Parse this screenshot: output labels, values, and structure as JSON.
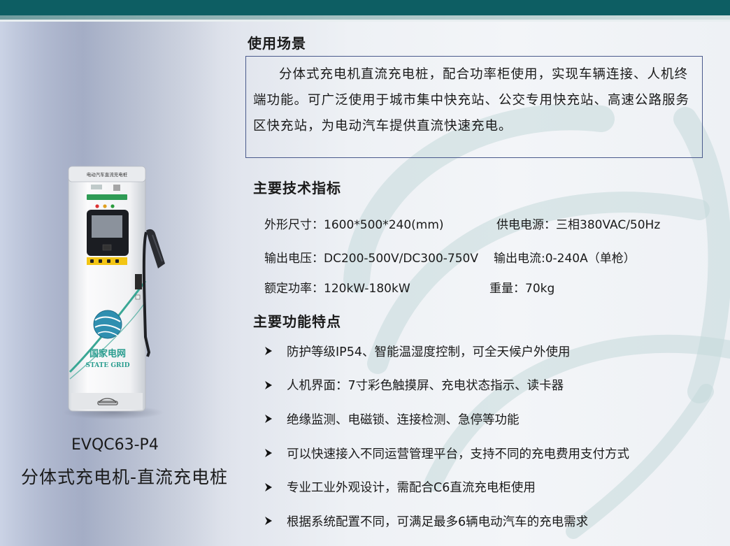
{
  "header": {
    "bar_color": "#0d5e63"
  },
  "usage": {
    "heading": "使用场景",
    "text": "分体式充电机直流充电桩，配合功率柜使用，实现车辆连接、人机终端功能。可广泛使用于城市集中快充站、公交专用快充站、高速公路服务区快充站，为电动汽车提供直流快速充电。"
  },
  "specs": {
    "heading": "主要技术指标",
    "size": "外形尺寸：1600*500*240(mm)",
    "power_supply": "供电电源：三相380VAC/50Hz",
    "output_voltage": "输出电压：DC200-500V/DC300-750V",
    "output_current": "输出电流:0-240A（单枪）",
    "rated_power": "额定功率：120kW-180kW",
    "weight": "重量：70kg"
  },
  "features": {
    "heading": "主要功能特点",
    "items": [
      "防护等级IP54、智能温湿度控制，可全天候户外使用",
      "人机界面：7寸彩色触摸屏、充电状态指示、读卡器",
      "绝缘监测、电磁锁、连接检测、急停等功能",
      "可以快速接入不同运营管理平台，支持不同的充电费用支付方式",
      "专业工业外观设计，需配合C6直流充电柜使用",
      "根据系统配置不同，可满足最多6辆电动汽车的充电需求"
    ]
  },
  "product": {
    "model": "EVQC63-P4",
    "name": "分体式充电机-直流充电桩",
    "device_top_label": "电动汽车直流充电桩",
    "brand_cn": "国家电网",
    "brand_en": "STATE GRID",
    "brand_color": "#2a9d8f"
  }
}
